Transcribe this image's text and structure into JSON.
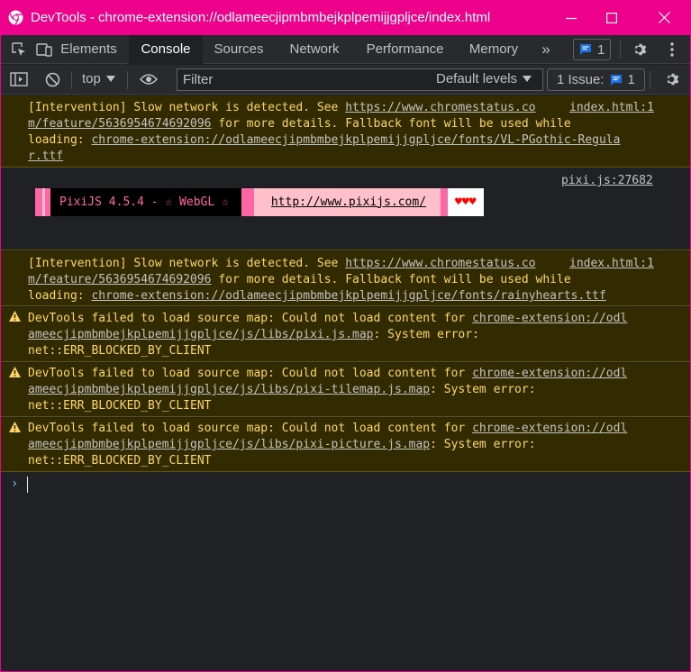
{
  "window": {
    "title": "DevTools - chrome-extension://odlameecjipmbmbejkplpemijjgpljce/index.html"
  },
  "tabs": {
    "items": [
      "Elements",
      "Console",
      "Sources",
      "Network",
      "Performance",
      "Memory"
    ],
    "active": "Console",
    "more_glyph": "»",
    "messages_count": "1"
  },
  "toolbar": {
    "context": "top",
    "filter_placeholder": "Filter",
    "levels": "Default levels",
    "issues_label": "1 Issue:",
    "issues_count": "1"
  },
  "console": {
    "msg1": {
      "line1_a": "[Intervention] Slow network is detected. See ",
      "line1_link": "https://www.chromestatus.co",
      "line2_link": "m/feature/5636954674692096",
      "line2_b": " for more details. Fallback font will be used while",
      "line3_a": "loading: ",
      "line3_link": "chrome-extension://odlameecjipmbmbejkplpemijjgpljce/fonts/VL-PGothic-Regula",
      "line4_link": "r.ttf",
      "source": "index.html:1"
    },
    "log": {
      "source": "pixi.js:27682",
      "banner_text": "PixiJS 4.5.4 - ☆ WebGL ☆",
      "banner_link": "http://www.pixijs.com/",
      "hearts": "♥♥♥"
    },
    "msg2": {
      "line1_a": "[Intervention] Slow network is detected. See ",
      "line1_link": "https://www.chromestatus.co",
      "line2_link": "m/feature/5636954674692096",
      "line2_b": " for more details. Fallback font will be used while",
      "line3_a": "loading: ",
      "line3_link": "chrome-extension://odlameecjipmbmbejkplpemijjgpljce/fonts/rainyhearts.ttf",
      "source": "index.html:1"
    },
    "warn1": {
      "line1_a": "DevTools failed to load source map: Could not load content for ",
      "line1_link": "chrome-extension://odl",
      "line2_link": "ameecjipmbmbejkplpemijjgpljce/js/libs/pixi.js.map",
      "line2_b": ": System error:",
      "line3": "net::ERR_BLOCKED_BY_CLIENT"
    },
    "warn2": {
      "line1_a": "DevTools failed to load source map: Could not load content for ",
      "line1_link": "chrome-extension://odl",
      "line2_link": "ameecjipmbmbejkplpemijjgpljce/js/libs/pixi-tilemap.js.map",
      "line2_b": ": System error:",
      "line3": "net::ERR_BLOCKED_BY_CLIENT"
    },
    "warn3": {
      "line1_a": "DevTools failed to load source map: Could not load content for ",
      "line1_link": "chrome-extension://odl",
      "line2_link": "ameecjipmbmbejkplpemijjgpljce/js/libs/pixi-picture.js.map",
      "line2_b": ": System error:",
      "line3": "net::ERR_BLOCKED_BY_CLIENT"
    },
    "prompt_glyph": "›"
  },
  "colors": {
    "titlebar": "#ec008c",
    "warning_bg": "#332b00",
    "warning_text": "#fdd663",
    "link_blue": "#8ab4f8",
    "banner_pink": "#ff66a5",
    "banner_light_pink": "#ffc0cb"
  }
}
